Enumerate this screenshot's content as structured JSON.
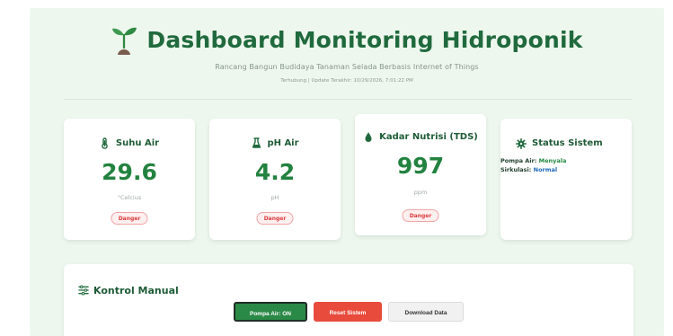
{
  "header": {
    "title": "Dashboard Monitoring Hidroponik",
    "subtitle": "Rancang Bangun Budidaya Tanaman Selada Berbasis Internet of Things",
    "connection_status": "Terhubung",
    "update_text": "Update Terakhir: 10/29/2026, 7:01:22 PM",
    "update_line": "Terhubung | Update Terakhir: 10/29/2026, 7:01:22 PM",
    "title_icon": "seedling-icon"
  },
  "cards": {
    "suhu": {
      "title": "Suhu Air",
      "value": "29.6",
      "unit": "°Celcius",
      "badge": "Danger",
      "icon": "thermometer-icon"
    },
    "ph": {
      "title": "pH Air",
      "value": "4.2",
      "unit": "pH",
      "badge": "Danger",
      "icon": "flask-icon"
    },
    "tds": {
      "title": "Kadar Nutrisi (TDS)",
      "value": "997",
      "unit": "ppm",
      "badge": "Danger",
      "icon": "droplet-icon"
    },
    "status": {
      "title": "Status Sistem",
      "pump_label": "Pompa Air:",
      "pump_value": "Menyala",
      "circulation_label": "Sirkulasi:",
      "circulation_value": "Normal",
      "icon": "gear-icon"
    }
  },
  "controls": {
    "title": "Kontrol Manual",
    "title_icon": "sliders-icon",
    "pump_button": "Pompa Air: ON",
    "reset_button": "Reset Sistem",
    "download_button": "Download Data"
  },
  "colors": {
    "primary_green": "#22823f",
    "dark_green": "#1e5b36",
    "background_green": "#eef7ee",
    "danger_red": "#dc3b3b",
    "reset_red": "#e84b3c",
    "status_blue": "#1d67b8"
  }
}
